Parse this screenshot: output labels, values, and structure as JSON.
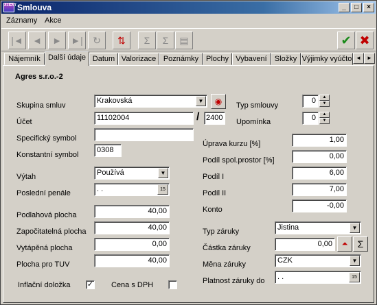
{
  "window": {
    "title": "Smlouva",
    "icon_text": "ALIENT",
    "minimize": "_",
    "maximize": "□",
    "close": "×"
  },
  "menu": {
    "items": [
      "Záznamy",
      "Akce"
    ]
  },
  "toolbar": {
    "icons": [
      "first-record-icon",
      "previous-record-icon",
      "next-record-icon",
      "last-record-icon",
      "refresh-icon",
      "sort-icon",
      "sum-icon",
      "subtotal-icon",
      "copy-icon"
    ],
    "glyphs": {
      "first": "|◄",
      "prev": "◄",
      "next": "►",
      "last": "►|",
      "refresh": "↻",
      "sort": "⇅",
      "sum": "Σ",
      "subsum": "Σ",
      "copy": "▤"
    },
    "ok_glyph": "✔",
    "cancel_glyph": "✖",
    "ok_color": "#1a8a1a",
    "cancel_color": "#c00000"
  },
  "tabs": {
    "items": [
      "Nájemník",
      "Další údaje",
      "Datum",
      "Valorizace",
      "Poznámky",
      "Plochy",
      "Vybavení",
      "Složky",
      "Výjimky vyúčto"
    ],
    "active": "Další údaje",
    "scroll_left": "◄",
    "scroll_right": "►"
  },
  "panel": {
    "company": "Agres s.r.o.-2",
    "skupina_smluv": {
      "label": "Skupina smluv",
      "value": "Krakovská"
    },
    "ucet": {
      "label": "Účet",
      "value": "11102004",
      "separator": "/",
      "bank": "2400"
    },
    "specificky_symbol": {
      "label": "Specifický symbol",
      "value": ""
    },
    "konstantni_symbol": {
      "label": "Konstantní symbol",
      "value": "0308"
    },
    "vytah": {
      "label": "Výtah",
      "value": "Používá"
    },
    "posledni_penale": {
      "label": "Poslední penále",
      "value": " .  ."
    },
    "typ_smlouvy": {
      "label": "Typ smlouvy",
      "value": "0"
    },
    "upominka": {
      "label": "Upomínka",
      "value": "0"
    },
    "uprava_kurzu": {
      "label": "Úprava kurzu [%]",
      "value": "1,00"
    },
    "podil_spol": {
      "label": "Podíl spol.prostor [%]",
      "value": "0,00"
    },
    "podil_i": {
      "label": "Podíl I",
      "value": "6,00"
    },
    "podil_ii": {
      "label": "Podíl II",
      "value": "7,00"
    },
    "konto": {
      "label": "Konto",
      "value": "-0,00"
    },
    "podlahova_plocha": {
      "label": "Podlahová plocha",
      "value": "40,00"
    },
    "zapocitatelna_plocha": {
      "label": "Započitatelná plocha",
      "value": "40,00"
    },
    "vytapena_plocha": {
      "label": "Vytápěná plocha",
      "value": "0,00"
    },
    "plocha_tuv": {
      "label": "Plocha pro TUV",
      "value": "40,00"
    },
    "typ_zaruky": {
      "label": "Typ záruky",
      "value": "Jistina"
    },
    "castka_zaruky": {
      "label": "Částka záruky",
      "value": "0,00"
    },
    "mena_zaruky": {
      "label": "Měna záruky",
      "value": "CZK"
    },
    "platnost_zaruky": {
      "label": "Platnost záruky do",
      "value": " .  ."
    },
    "inflacni_dolozka": {
      "label": "Inflační doložka",
      "checked": true,
      "mark": "✓"
    },
    "cena_s_dph": {
      "label": "Cena s DPH",
      "checked": false,
      "mark": ""
    },
    "combo_arrow": "▼",
    "spin_up": "▲",
    "spin_down": "▼",
    "cal_glyph": "15",
    "sum_glyph": "Σ",
    "chart_glyph": "⏶"
  }
}
